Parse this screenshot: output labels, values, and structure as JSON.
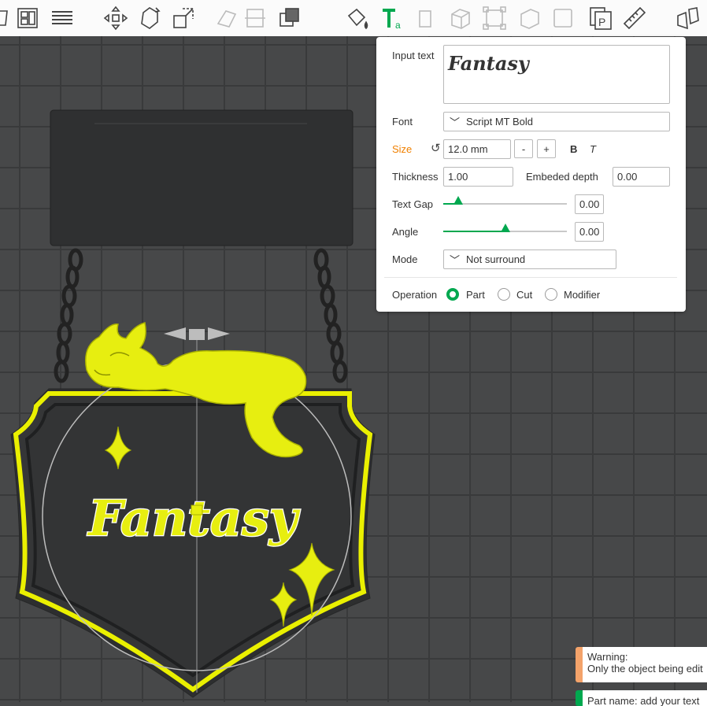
{
  "toolbar": {
    "icons": [
      "orient-icon",
      "arrange-icon",
      "layers-icon",
      "move-icon",
      "rotate-icon",
      "scale-icon",
      "lay-on-face-icon",
      "cut-icon",
      "boolean-icon",
      "paint-icon",
      "text-tool-icon",
      "support-paint-icon",
      "box-icon",
      "brim-icon",
      "assembly-icon",
      "seam-icon",
      "variable-layer-icon",
      "measure-icon",
      "split-parts-icon"
    ]
  },
  "text_panel": {
    "input_text_label": "Input text",
    "input_text_value": "Fantasy",
    "font_label": "Font",
    "font_value": "Script MT Bold",
    "size_label": "Size",
    "size_value": "12.0 mm",
    "minus": "-",
    "plus": "+",
    "bold": "B",
    "italic": "T",
    "thickness_label": "Thickness",
    "thickness_value": "1.00",
    "embed_label": "Embeded depth",
    "embed_value": "0.00",
    "text_gap_label": "Text Gap",
    "text_gap_value": "0.00",
    "text_gap_level": 0.12,
    "angle_label": "Angle",
    "angle_value": "0.00",
    "angle_level": 0.5,
    "mode_label": "Mode",
    "mode_value": "Not surround",
    "operation_label": "Operation",
    "op_part": "Part",
    "op_cut": "Cut",
    "op_modifier": "Modifier",
    "op_selected": "Part"
  },
  "scene": {
    "sign_text": "Fantasy"
  },
  "notifications": {
    "warning_title": "Warning:",
    "warning_text": "Only the object being edit",
    "part_name": "Part name: add your text"
  },
  "colors": {
    "accent": "#00a84f",
    "model_yellow": "#eaf000",
    "plate_dark": "#2e2f30",
    "size_label": "#f08000"
  }
}
